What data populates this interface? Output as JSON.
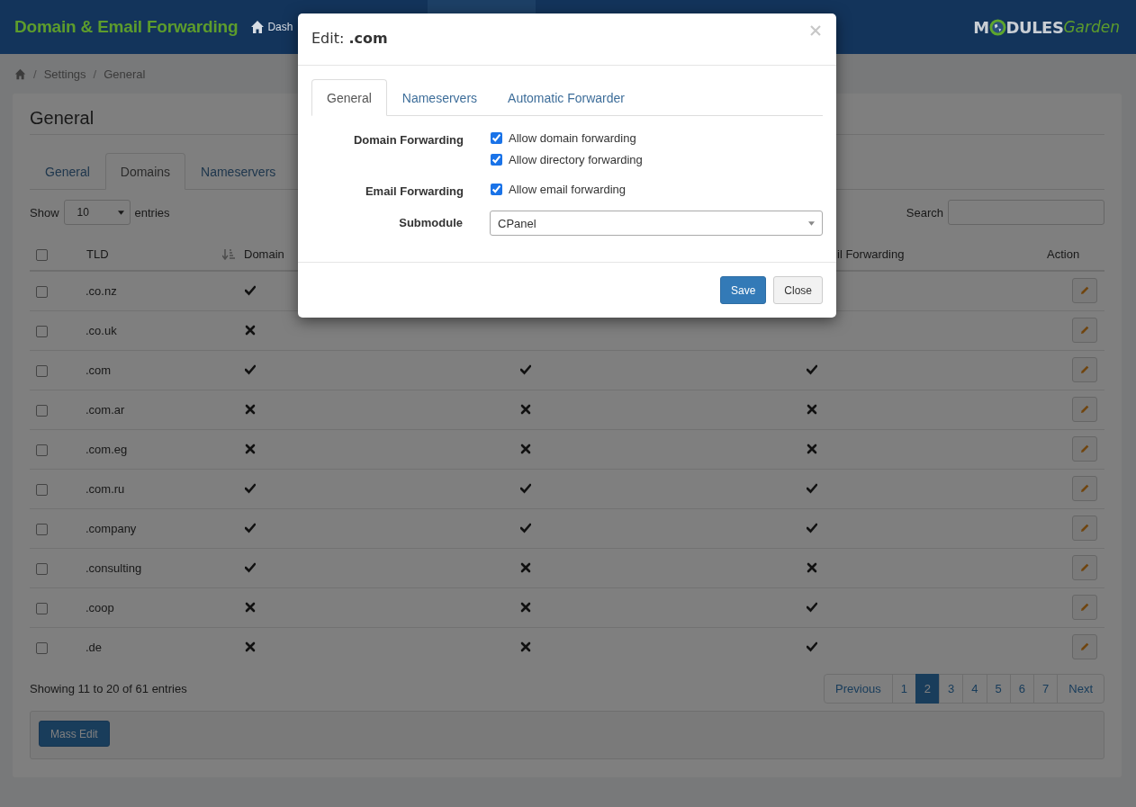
{
  "header": {
    "title": "Domain & Email Forwarding",
    "nav": [
      {
        "label": "Dash"
      }
    ],
    "logo": [
      "M",
      "DULES",
      "Garden"
    ]
  },
  "breadcrumb": [
    {
      "kind": "separator",
      "label": "/"
    },
    {
      "kind": "link",
      "label": "Settings"
    },
    {
      "kind": "separator",
      "label": "/"
    },
    {
      "kind": "link",
      "label": "General"
    }
  ],
  "card": {
    "title": "General",
    "tabs": [
      {
        "label": "General",
        "selected": false
      },
      {
        "label": "Domains",
        "selected": true
      },
      {
        "label": "Nameservers",
        "selected": false
      }
    ]
  },
  "table": {
    "show_label": "Show",
    "page_size": "10",
    "entries_label": "entries",
    "search_label": "Search",
    "select_all_checked": false,
    "columns": [
      "TLD",
      "Domain",
      "",
      "il Forwarding",
      "Action"
    ],
    "rows": [
      {
        "checked": false,
        "tld": ".co.nz",
        "column_2": true
      },
      {
        "checked": false,
        "tld": ".co.uk",
        "column_2": false
      },
      {
        "checked": false,
        "tld": ".com",
        "column_2": true,
        "column_3": true,
        "column_4": true
      },
      {
        "checked": false,
        "tld": ".com.ar",
        "column_2": false,
        "column_3": false,
        "column_4": false
      },
      {
        "checked": false,
        "tld": ".com.eg",
        "column_2": false,
        "column_3": false,
        "column_4": false
      },
      {
        "checked": false,
        "tld": ".com.ru",
        "column_2": true,
        "column_3": true,
        "column_4": true
      },
      {
        "checked": false,
        "tld": ".company",
        "column_2": true,
        "column_3": true,
        "column_4": true
      },
      {
        "checked": false,
        "tld": ".consulting",
        "column_2": true,
        "column_3": false,
        "column_4": false
      },
      {
        "checked": false,
        "tld": ".coop",
        "column_2": false,
        "column_3": false,
        "column_4": true
      },
      {
        "checked": false,
        "tld": ".de",
        "column_2": false,
        "column_3": false,
        "column_4": true
      }
    ],
    "info": "Showing 11 to 20 of 61 entries",
    "pagination": [
      {
        "label": "Previous",
        "selected": false
      },
      {
        "label": "1",
        "selected": false
      },
      {
        "label": "2",
        "selected": true
      },
      {
        "label": "3",
        "selected": false
      },
      {
        "label": "4",
        "selected": false
      },
      {
        "label": "5",
        "selected": false
      },
      {
        "label": "6",
        "selected": false
      },
      {
        "label": "7",
        "selected": false
      },
      {
        "label": "Next",
        "selected": false
      }
    ],
    "mass_edit": "Mass Edit"
  },
  "modal": {
    "title_prefix": "Edit:",
    "title_name": ".com",
    "tabs": [
      {
        "label": "General",
        "selected": true
      },
      {
        "label": "Nameservers",
        "selected": false
      },
      {
        "label": "Automatic Forwarder",
        "selected": false
      }
    ],
    "groups": [
      {
        "label": "Domain Forwarding",
        "options": [
          {
            "label": "Allow domain forwarding",
            "checked": true
          },
          {
            "label": "Allow directory forwarding",
            "checked": true
          }
        ]
      },
      {
        "label": "Email Forwarding",
        "options": [
          {
            "label": "Allow email forwarding",
            "checked": true
          }
        ]
      }
    ],
    "submodule": {
      "label": "Submodule",
      "value": "CPanel"
    },
    "buttons": [
      {
        "label": "Save",
        "kind": "primary"
      },
      {
        "label": "Close",
        "kind": "default"
      }
    ]
  }
}
